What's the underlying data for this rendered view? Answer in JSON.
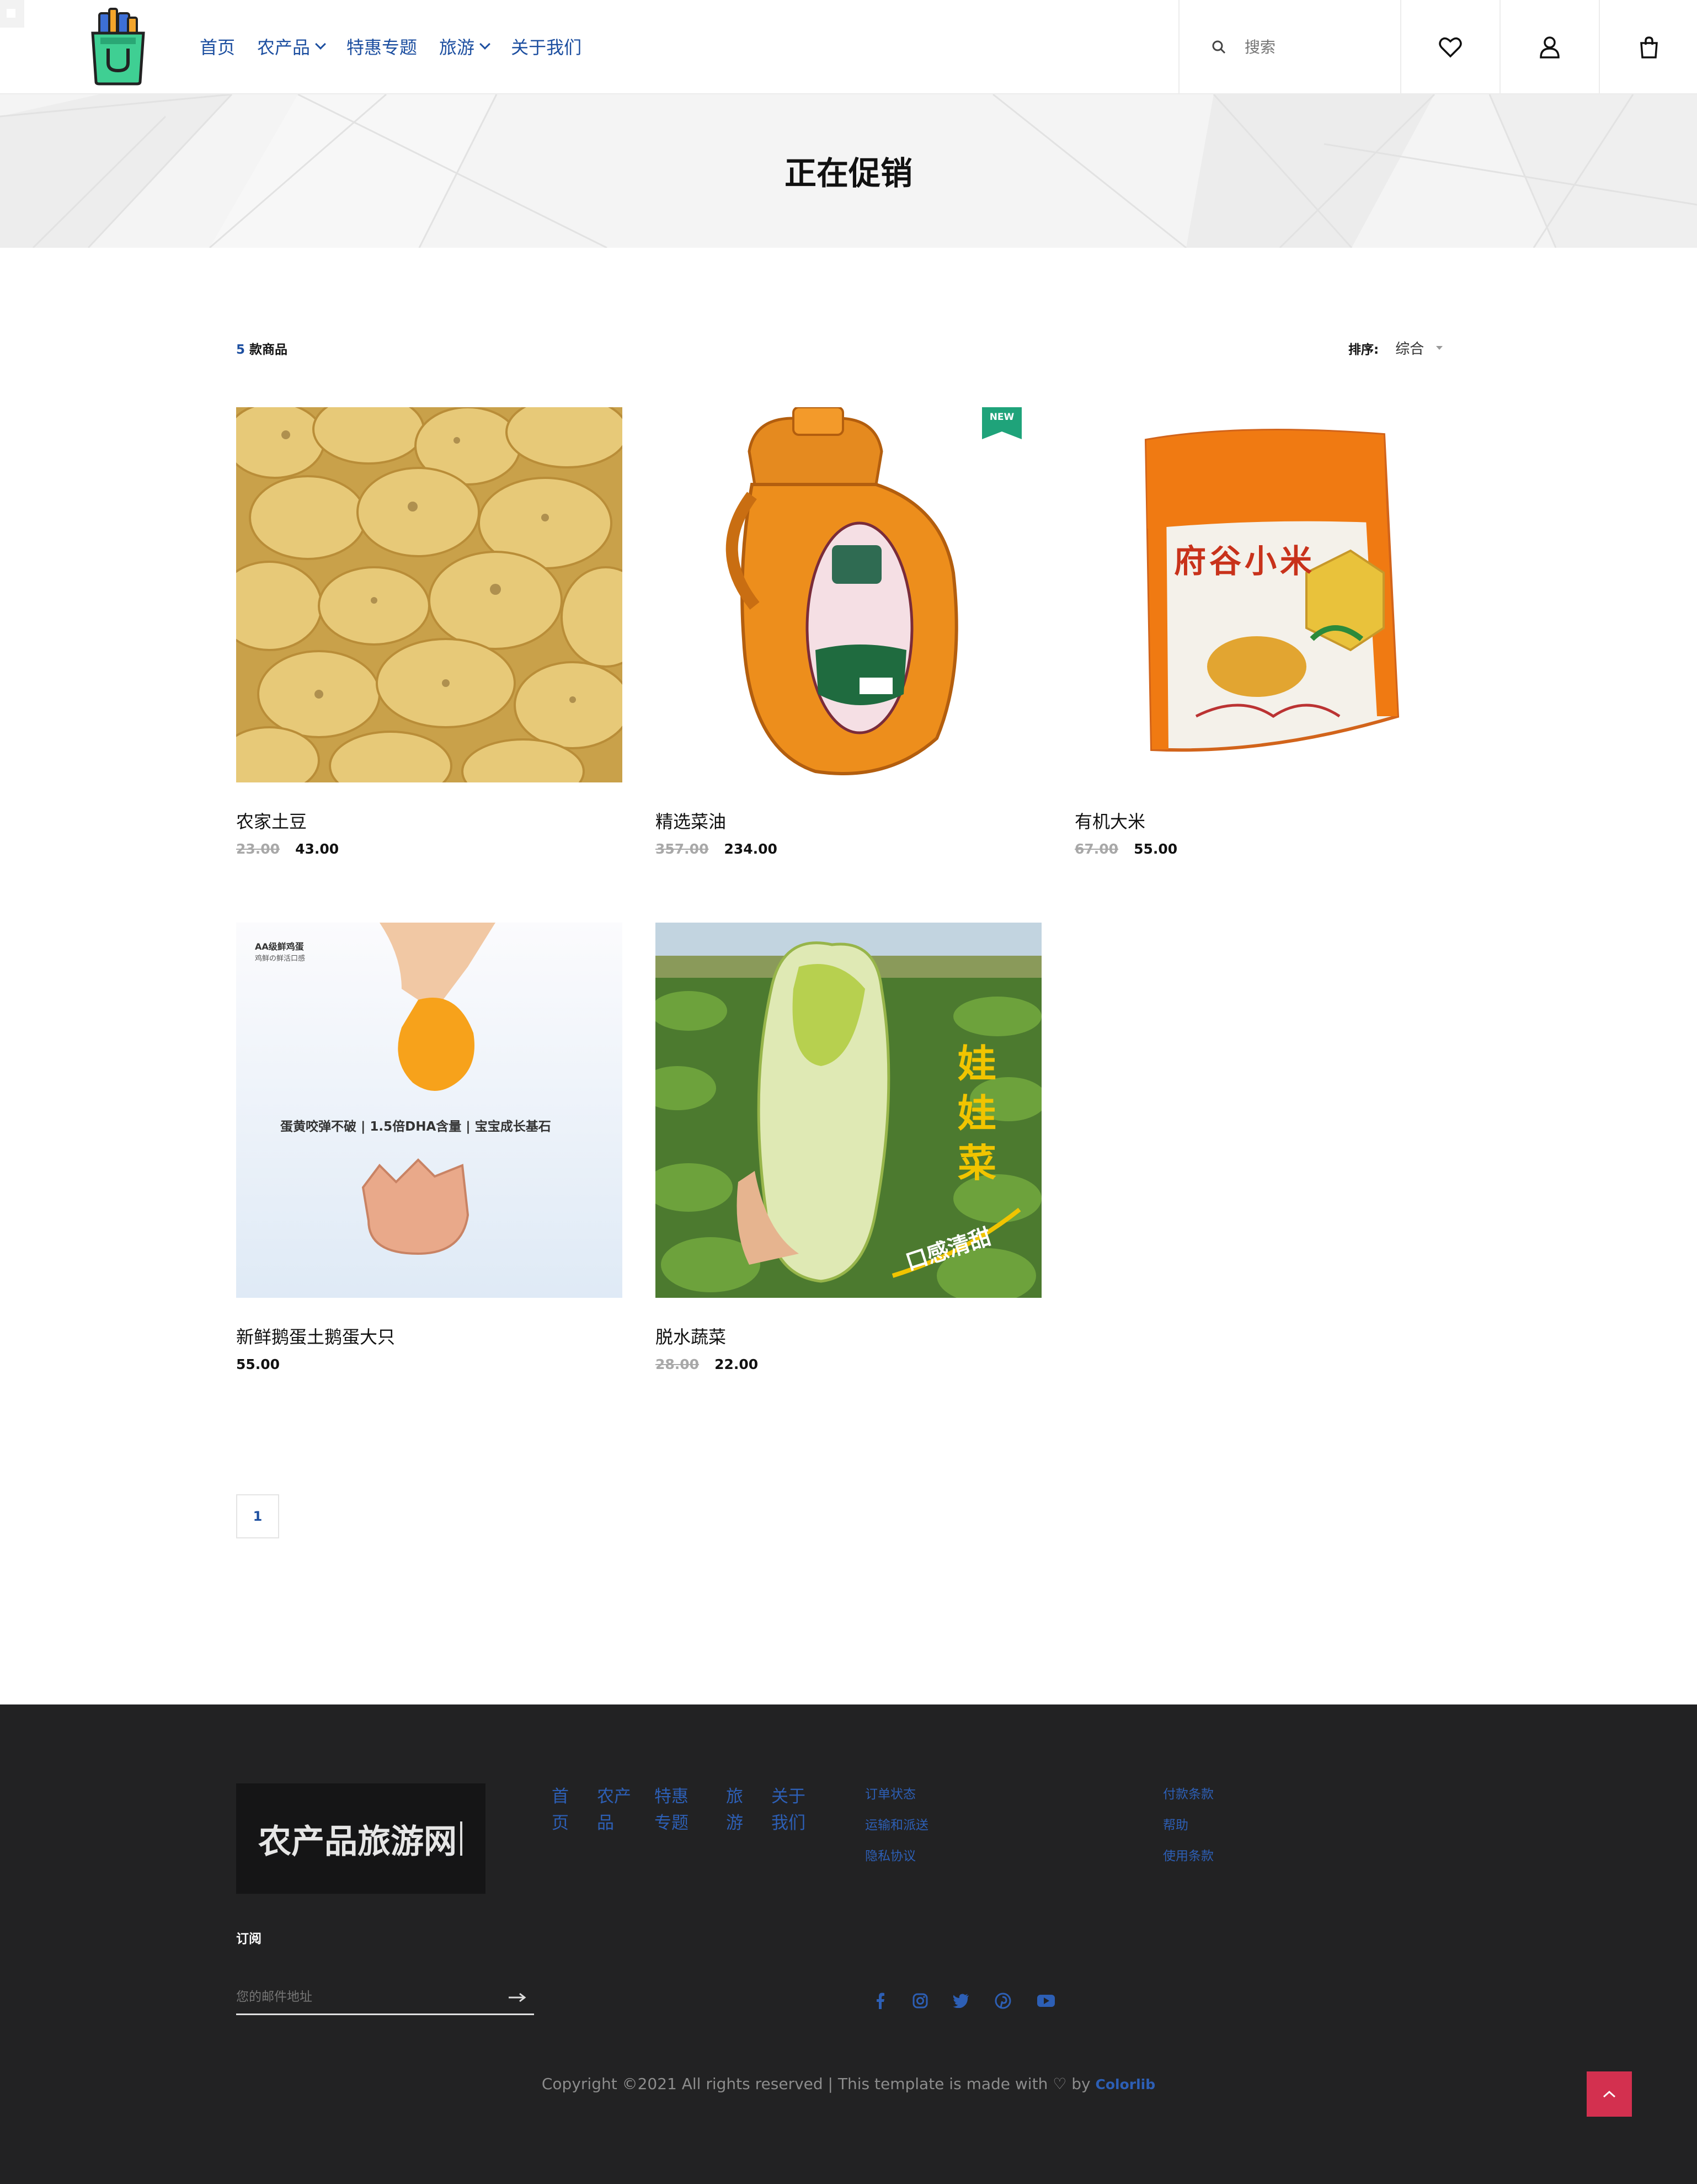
{
  "header": {
    "nav": [
      {
        "label": "首页",
        "dropdown": false
      },
      {
        "label": "农产品",
        "dropdown": true
      },
      {
        "label": "特惠专题",
        "dropdown": false
      },
      {
        "label": "旅游",
        "dropdown": true
      },
      {
        "label": "关于我们",
        "dropdown": false
      }
    ],
    "search_placeholder": "搜索",
    "icons": {
      "search": "search-icon",
      "wishlist": "heart-icon",
      "account": "user-icon",
      "cart": "shopping-bag-icon"
    }
  },
  "banner": {
    "title": "正在促销"
  },
  "toolbar": {
    "count": "5",
    "count_suffix": "款商品",
    "sort_label": "排序:",
    "sort_value": "综合"
  },
  "products": [
    {
      "name": "农家土豆",
      "old_price": "23.00",
      "price": "43.00",
      "badge": ""
    },
    {
      "name": "精选菜油",
      "old_price": "357.00",
      "price": "234.00",
      "badge": "NEW"
    },
    {
      "name": "有机大米",
      "old_price": "67.00",
      "price": "55.00",
      "badge": ""
    },
    {
      "name": "新鲜鹅蛋土鹅蛋大只",
      "old_price": "",
      "price": "55.00",
      "badge": ""
    },
    {
      "name": "脱水蔬菜",
      "old_price": "28.00",
      "price": "22.00",
      "badge": ""
    }
  ],
  "product_images": {
    "rice_title": "府谷小米",
    "egg_caption": "蛋黄咬弹不破 | 1.5倍DHA含量 | 宝宝成长基石",
    "egg_tag": "AA级鲜鸡蛋",
    "egg_tag_sub": "鸡鲜の鲜活口感",
    "cabbage_title": [
      "娃",
      "娃",
      "菜"
    ],
    "cabbage_slogan": "口感清甜"
  },
  "pagination": {
    "current": "1"
  },
  "footer": {
    "logo_text": "农产品旅游网",
    "nav": [
      {
        "label": "首页"
      },
      {
        "label": "农产品"
      },
      {
        "label": "特惠专题"
      },
      {
        "label": "旅游"
      },
      {
        "label": "关于我们"
      }
    ],
    "links_col1": [
      "订单状态",
      "运输和派送",
      "隐私协议"
    ],
    "links_col2": [
      "付款条款",
      "帮助",
      "使用条款"
    ],
    "subscribe_title": "订阅",
    "subscribe_placeholder": "您的邮件地址",
    "social": [
      "facebook-icon",
      "instagram-icon",
      "twitter-icon",
      "pinterest-icon",
      "youtube-icon"
    ],
    "copyright_pre": "Copyright ©2021 All rights reserved | This template is made with",
    "copyright_by": "by",
    "copyright_brand": "Colorlib"
  },
  "colors": {
    "link": "#1d4fa0",
    "footer_bg": "#222223",
    "accent_red": "#d3304f",
    "badge_green": "#1fa37a"
  }
}
